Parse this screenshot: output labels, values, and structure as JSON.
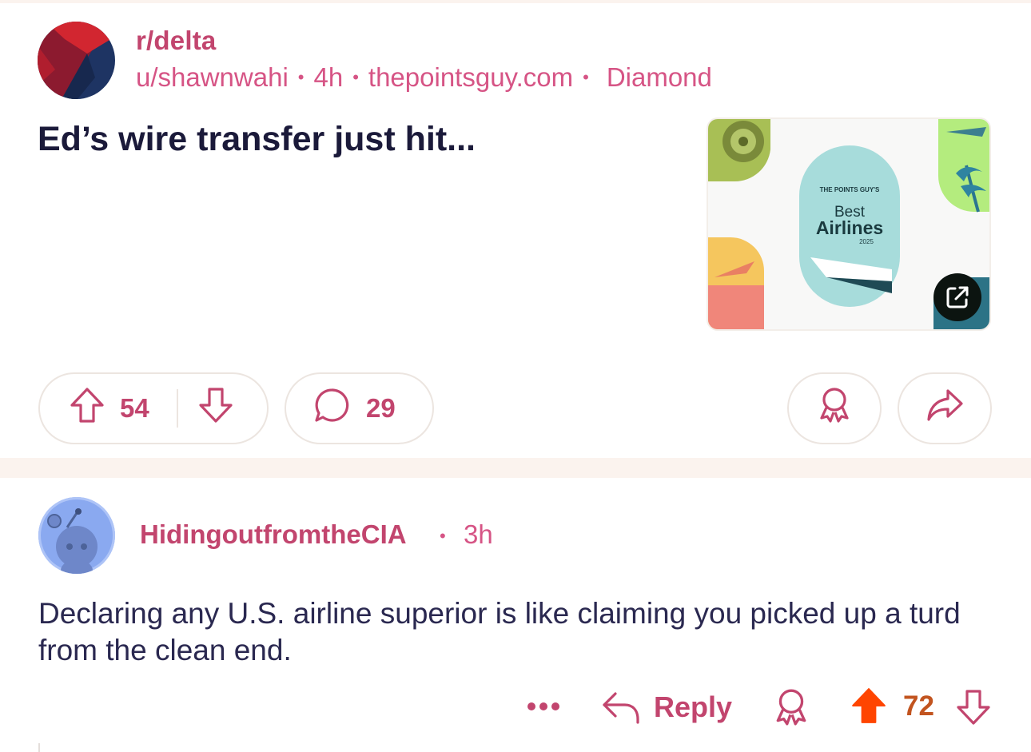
{
  "post": {
    "subreddit": "r/delta",
    "author": "u/shawnwahi",
    "age": "4h",
    "domain": "thepointsguy.com",
    "flair": "Diamond",
    "title": "Ed’s wire transfer just hit...",
    "thumbnail": {
      "eyebrow": "THE POINTS GUY'S",
      "line1": "Best",
      "line2": "Airlines",
      "year": "2025"
    },
    "upvotes": "54",
    "comments": "29"
  },
  "comment": {
    "author": "HidingoutfromtheCIA",
    "separator": "•",
    "age": "3h",
    "body": "Declaring any U.S. airline superior is like claiming you picked up a turd from the clean end.",
    "reply_label": "Reply",
    "score": "72",
    "vote_state": "upvoted"
  },
  "colors": {
    "accent": "#c2456e",
    "meta": "#d65485",
    "title": "#1b1a3a",
    "upvote_active": "#ff4500",
    "score_active": "#c2541f",
    "separator_band": "#fbf3ee"
  },
  "icons": [
    "upvote-icon",
    "downvote-icon",
    "comment-icon",
    "award-icon",
    "share-icon",
    "external-link-icon",
    "more-icon",
    "reply-icon"
  ]
}
